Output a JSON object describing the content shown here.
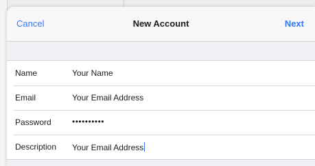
{
  "nav": {
    "cancel_label": "Cancel",
    "title": "New Account",
    "next_label": "Next"
  },
  "form": {
    "rows": [
      {
        "label": "Name",
        "value": "Your Name"
      },
      {
        "label": "Email",
        "value": "Your Email Address"
      },
      {
        "label": "Password",
        "value": "••••••••••"
      },
      {
        "label": "Description",
        "value": "Your Email Address"
      }
    ]
  },
  "colors": {
    "accent": "#3478f6",
    "sheet_background": "#efeff4",
    "row_background": "#ffffff"
  }
}
